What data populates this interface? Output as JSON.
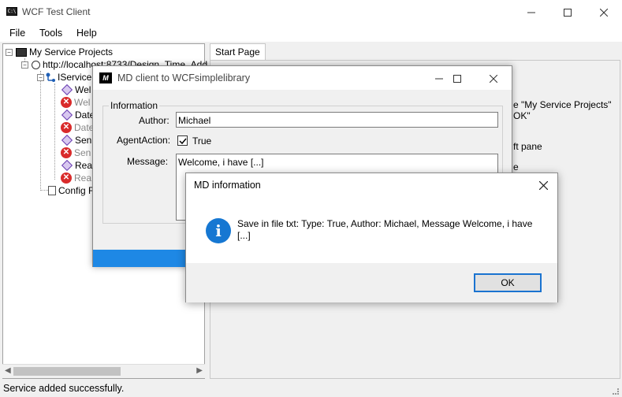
{
  "main_window": {
    "title": "WCF Test Client",
    "app_icon_text": "C:\\"
  },
  "menu": {
    "items": [
      {
        "label": "File"
      },
      {
        "label": "Tools"
      },
      {
        "label": "Help"
      }
    ]
  },
  "tree": {
    "root_label": "My Service Projects",
    "endpoint_label": "http://localhost:8733/Design_Time_Addr",
    "interface_label": "IService",
    "methods": [
      {
        "label": "Wel",
        "error": false
      },
      {
        "label": "Wel",
        "error": true
      },
      {
        "label": "Date",
        "error": false
      },
      {
        "label": "Date",
        "error": true
      },
      {
        "label": "Sen",
        "error": false
      },
      {
        "label": "Sen",
        "error": true
      },
      {
        "label": "Rea",
        "error": false
      },
      {
        "label": "Rea",
        "error": true
      }
    ],
    "config_label": "Config F"
  },
  "right_pane": {
    "tab_label": "Start Page",
    "fragments": [
      "e \"My Service Projects\"",
      "OK\"",
      "ft pane",
      "e"
    ]
  },
  "status": {
    "text": "Service added successfully."
  },
  "md_client_dialog": {
    "icon_text": "M",
    "title": "MD client to WCFsimplelibrary",
    "group_title": "Information",
    "author_label": "Author:",
    "author_value": "Michael",
    "agent_label": "AgentAction:",
    "agent_checked": true,
    "agent_value_label": "True",
    "message_label": "Message:",
    "message_value": "Welcome, i have [...]"
  },
  "info_dialog": {
    "title": "MD information",
    "icon_text": "i",
    "message": "Save in file txt: Type: True, Author: Michael, Message Welcome, i have [...]",
    "ok_label": "OK"
  },
  "colors": {
    "accent": "#1e88e5",
    "error": "#d92b2b",
    "info_icon": "#1677d2"
  }
}
